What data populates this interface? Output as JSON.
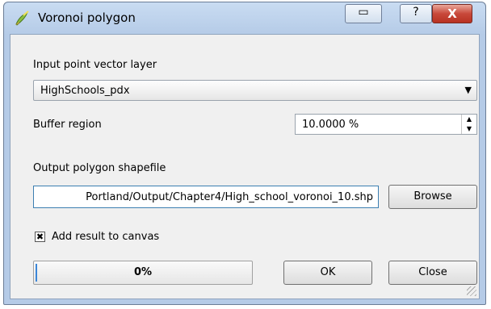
{
  "window": {
    "title": "Voronoi polygon",
    "app_icon": "qgis-brush-icon"
  },
  "titlebar_buttons": {
    "restore": "▭",
    "help": "?",
    "close": "X"
  },
  "input_layer": {
    "label": "Input point vector layer",
    "value": "HighSchools_pdx"
  },
  "buffer": {
    "label": "Buffer region",
    "value": "10.0000 %"
  },
  "output": {
    "label": "Output polygon shapefile",
    "path": "Portland/Output/Chapter4/High_school_voronoi_10.shp",
    "browse_label": "Browse"
  },
  "add_to_canvas": {
    "label": "Add result to canvas",
    "checked": true,
    "mark": "✖"
  },
  "progress": {
    "value": 0,
    "text": "0%"
  },
  "buttons": {
    "ok": "OK",
    "close": "Close"
  }
}
